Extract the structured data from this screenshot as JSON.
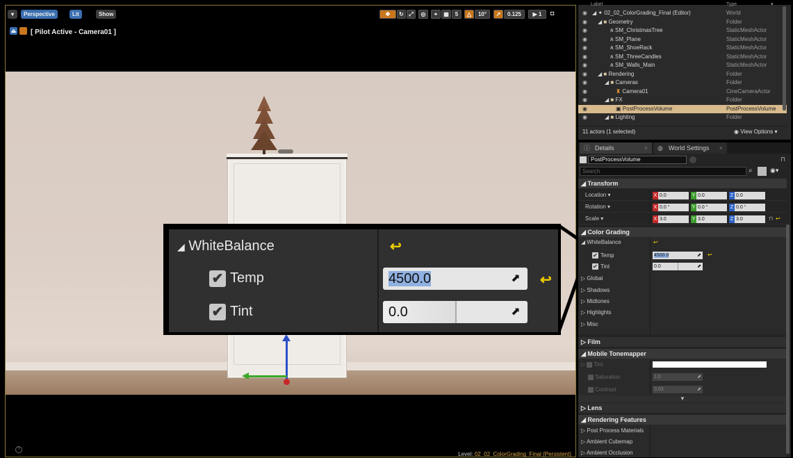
{
  "viewport": {
    "toolbar": {
      "menu_icon": "dropdown-arrow-icon",
      "perspective": "Perspective",
      "lit": "Lit",
      "show": "Show",
      "snap_angle": "10°",
      "snap_scale": "0.125",
      "camera_speed": "1",
      "grid_size": "5"
    },
    "pilot_label": "[ Pilot Active - Camera01 ]",
    "level_prefix": "Level:",
    "level_name": "02_02_ColorGrading_Final (Persistent)"
  },
  "callout": {
    "section": "WhiteBalance",
    "temp_label": "Temp",
    "temp_value": "4500.0",
    "tint_label": "Tint",
    "tint_value": "0.0"
  },
  "outliner": {
    "header_label": "Label",
    "header_type": "Type",
    "rows": [
      {
        "name": "02_02_ColorGrading_Final (Editor)",
        "type": "World"
      },
      {
        "name": "Geometry",
        "type": "Folder"
      },
      {
        "name": "SM_ChristmasTree",
        "type": "StaticMeshActor"
      },
      {
        "name": "SM_Plane",
        "type": "StaticMeshActor"
      },
      {
        "name": "SM_ShoeRack",
        "type": "StaticMeshActor"
      },
      {
        "name": "SM_ThreeCandles",
        "type": "StaticMeshActor"
      },
      {
        "name": "SM_Walls_Main",
        "type": "StaticMeshActor"
      },
      {
        "name": "Rendering",
        "type": "Folder"
      },
      {
        "name": "Cameras",
        "type": "Folder"
      },
      {
        "name": "Camera01",
        "type": "CineCameraActor"
      },
      {
        "name": "FX",
        "type": "Folder"
      },
      {
        "name": "PostProcessVolume",
        "type": "PostProcessVolume"
      },
      {
        "name": "Lighting",
        "type": "Folder"
      }
    ],
    "footer_count": "11 actors (1 selected)",
    "view_options": "View Options"
  },
  "details": {
    "tab_details": "Details",
    "tab_world": "World Settings",
    "object_name": "PostProcessVolume",
    "search_placeholder": "Search",
    "transform": "Transform",
    "location": "Location",
    "rotation": "Rotation",
    "scale": "Scale",
    "loc": [
      "0.0",
      "0.0",
      "0.0"
    ],
    "rot": [
      "0.0 °",
      "0.0 °",
      "0.0 °"
    ],
    "scl": [
      "3.0",
      "3.0",
      "3.0"
    ],
    "color_grading": "Color Grading",
    "white_balance": "WhiteBalance",
    "temp": "Temp",
    "temp_value": "4500.0",
    "tint": "Tint",
    "tint_value": "0.0",
    "global": "Global",
    "shadows": "Shadows",
    "midtones": "Midtones",
    "highlights": "Highlights",
    "misc": "Misc",
    "film": "Film",
    "mobile_tonemapper": "Mobile Tonemapper",
    "mt_tint": "Tint",
    "saturation": "Saturation",
    "saturation_value": "1.0",
    "contrast": "Contrast",
    "contrast_value": "0.03",
    "lens": "Lens",
    "rendering_features": "Rendering Features",
    "post_process_materials": "Post Process Materials",
    "ambient_cubemap": "Ambient Cubemap",
    "ambient_occlusion": "Ambient Occlusion"
  }
}
